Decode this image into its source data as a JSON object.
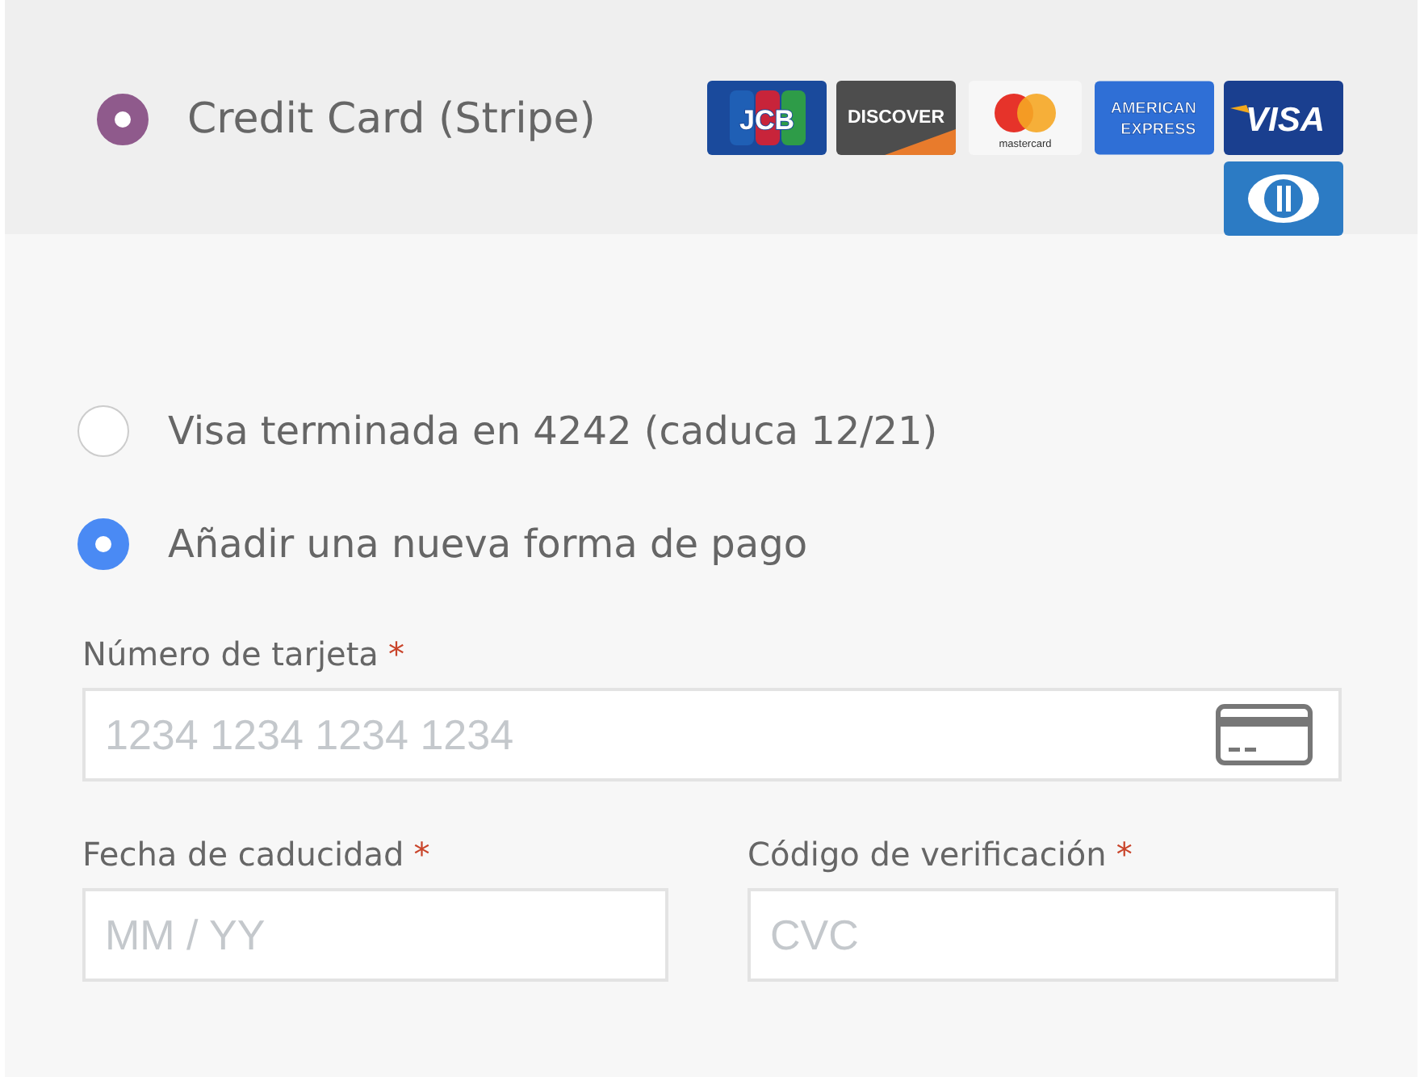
{
  "payment_method": {
    "label": "Credit Card (Stripe)",
    "selected": true
  },
  "card_logos": [
    {
      "kind": "jcb",
      "label": "JCB"
    },
    {
      "kind": "discover",
      "label": "DISCOVER"
    },
    {
      "kind": "mastercard",
      "label": "mastercard"
    },
    {
      "kind": "amex",
      "label": "AMERICAN EXPRESS"
    },
    {
      "kind": "visa",
      "label": "VISA"
    },
    {
      "kind": "diners"
    }
  ],
  "saved_options": [
    {
      "label": "Visa terminada en 4242 (caduca 12/21)",
      "selected": false
    },
    {
      "label": "Añadir una nueva forma de pago",
      "selected": true
    }
  ],
  "card_number": {
    "label": "Número de tarjeta",
    "required": true,
    "required_mark": "*",
    "placeholder": "1234 1234 1234 1234"
  },
  "expiry": {
    "label": "Fecha de caducidad",
    "required": true,
    "required_mark": "*",
    "placeholder": "MM / YY"
  },
  "cvc": {
    "label": "Código de verificación",
    "required": true,
    "required_mark": "*",
    "placeholder": "CVC"
  }
}
